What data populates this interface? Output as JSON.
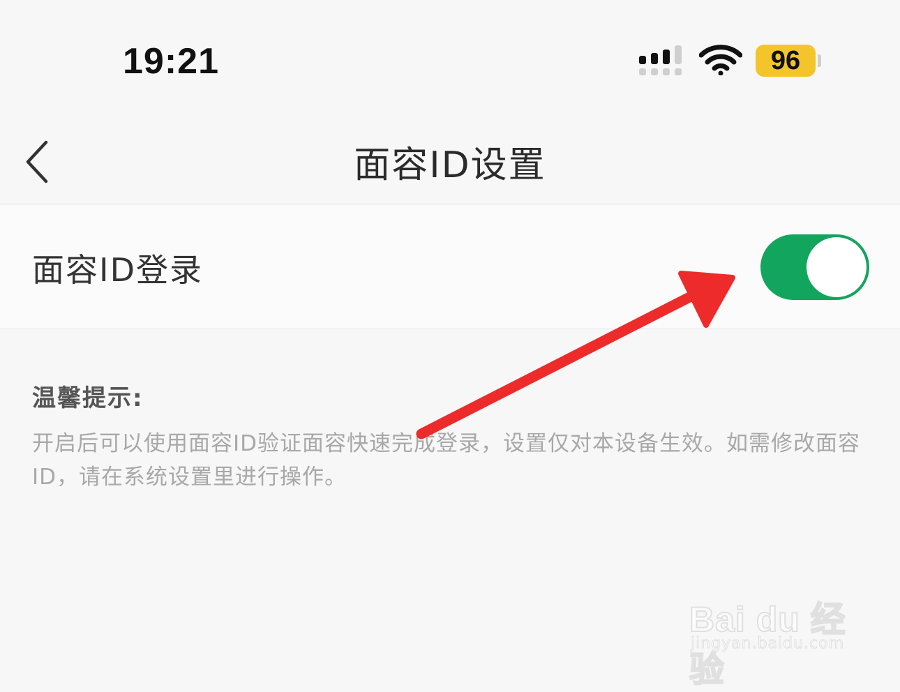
{
  "status_bar": {
    "time": "19:21",
    "battery": "96"
  },
  "nav": {
    "title": "面容ID设置"
  },
  "setting": {
    "label": "面容ID登录",
    "enabled": true
  },
  "tips": {
    "title": "温馨提示:",
    "body": "开启后可以使用面容ID验证面容快速完成登录，设置仅对本设备生效。如需修改面容ID，请在系统设置里进行操作。"
  },
  "watermark": {
    "logo": "Bai du 经验",
    "url": "jingyan.baidu.com"
  },
  "colors": {
    "toggle_on": "#12a55e",
    "battery": "#f3c52b",
    "arrow": "#ee2b2b"
  }
}
